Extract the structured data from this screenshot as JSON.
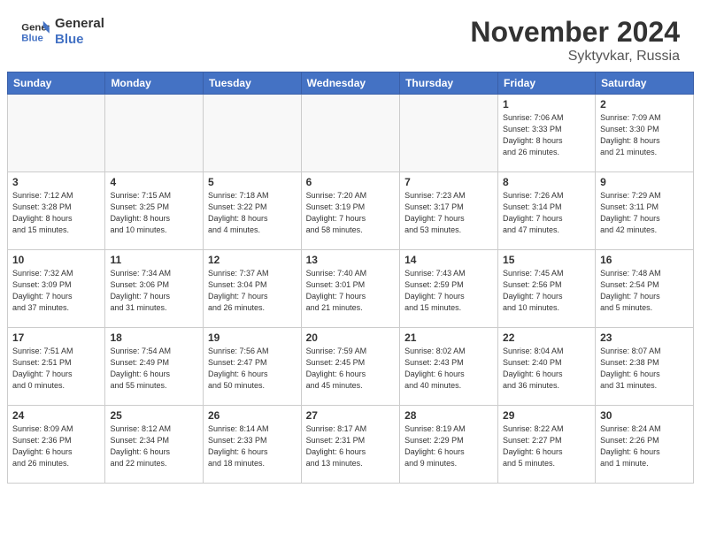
{
  "header": {
    "logo_line1": "General",
    "logo_line2": "Blue",
    "month": "November 2024",
    "location": "Syktyvkar, Russia"
  },
  "weekdays": [
    "Sunday",
    "Monday",
    "Tuesday",
    "Wednesday",
    "Thursday",
    "Friday",
    "Saturday"
  ],
  "rows": [
    [
      {
        "day": "",
        "info": ""
      },
      {
        "day": "",
        "info": ""
      },
      {
        "day": "",
        "info": ""
      },
      {
        "day": "",
        "info": ""
      },
      {
        "day": "",
        "info": ""
      },
      {
        "day": "1",
        "info": "Sunrise: 7:06 AM\nSunset: 3:33 PM\nDaylight: 8 hours\nand 26 minutes."
      },
      {
        "day": "2",
        "info": "Sunrise: 7:09 AM\nSunset: 3:30 PM\nDaylight: 8 hours\nand 21 minutes."
      }
    ],
    [
      {
        "day": "3",
        "info": "Sunrise: 7:12 AM\nSunset: 3:28 PM\nDaylight: 8 hours\nand 15 minutes."
      },
      {
        "day": "4",
        "info": "Sunrise: 7:15 AM\nSunset: 3:25 PM\nDaylight: 8 hours\nand 10 minutes."
      },
      {
        "day": "5",
        "info": "Sunrise: 7:18 AM\nSunset: 3:22 PM\nDaylight: 8 hours\nand 4 minutes."
      },
      {
        "day": "6",
        "info": "Sunrise: 7:20 AM\nSunset: 3:19 PM\nDaylight: 7 hours\nand 58 minutes."
      },
      {
        "day": "7",
        "info": "Sunrise: 7:23 AM\nSunset: 3:17 PM\nDaylight: 7 hours\nand 53 minutes."
      },
      {
        "day": "8",
        "info": "Sunrise: 7:26 AM\nSunset: 3:14 PM\nDaylight: 7 hours\nand 47 minutes."
      },
      {
        "day": "9",
        "info": "Sunrise: 7:29 AM\nSunset: 3:11 PM\nDaylight: 7 hours\nand 42 minutes."
      }
    ],
    [
      {
        "day": "10",
        "info": "Sunrise: 7:32 AM\nSunset: 3:09 PM\nDaylight: 7 hours\nand 37 minutes."
      },
      {
        "day": "11",
        "info": "Sunrise: 7:34 AM\nSunset: 3:06 PM\nDaylight: 7 hours\nand 31 minutes."
      },
      {
        "day": "12",
        "info": "Sunrise: 7:37 AM\nSunset: 3:04 PM\nDaylight: 7 hours\nand 26 minutes."
      },
      {
        "day": "13",
        "info": "Sunrise: 7:40 AM\nSunset: 3:01 PM\nDaylight: 7 hours\nand 21 minutes."
      },
      {
        "day": "14",
        "info": "Sunrise: 7:43 AM\nSunset: 2:59 PM\nDaylight: 7 hours\nand 15 minutes."
      },
      {
        "day": "15",
        "info": "Sunrise: 7:45 AM\nSunset: 2:56 PM\nDaylight: 7 hours\nand 10 minutes."
      },
      {
        "day": "16",
        "info": "Sunrise: 7:48 AM\nSunset: 2:54 PM\nDaylight: 7 hours\nand 5 minutes."
      }
    ],
    [
      {
        "day": "17",
        "info": "Sunrise: 7:51 AM\nSunset: 2:51 PM\nDaylight: 7 hours\nand 0 minutes."
      },
      {
        "day": "18",
        "info": "Sunrise: 7:54 AM\nSunset: 2:49 PM\nDaylight: 6 hours\nand 55 minutes."
      },
      {
        "day": "19",
        "info": "Sunrise: 7:56 AM\nSunset: 2:47 PM\nDaylight: 6 hours\nand 50 minutes."
      },
      {
        "day": "20",
        "info": "Sunrise: 7:59 AM\nSunset: 2:45 PM\nDaylight: 6 hours\nand 45 minutes."
      },
      {
        "day": "21",
        "info": "Sunrise: 8:02 AM\nSunset: 2:43 PM\nDaylight: 6 hours\nand 40 minutes."
      },
      {
        "day": "22",
        "info": "Sunrise: 8:04 AM\nSunset: 2:40 PM\nDaylight: 6 hours\nand 36 minutes."
      },
      {
        "day": "23",
        "info": "Sunrise: 8:07 AM\nSunset: 2:38 PM\nDaylight: 6 hours\nand 31 minutes."
      }
    ],
    [
      {
        "day": "24",
        "info": "Sunrise: 8:09 AM\nSunset: 2:36 PM\nDaylight: 6 hours\nand 26 minutes."
      },
      {
        "day": "25",
        "info": "Sunrise: 8:12 AM\nSunset: 2:34 PM\nDaylight: 6 hours\nand 22 minutes."
      },
      {
        "day": "26",
        "info": "Sunrise: 8:14 AM\nSunset: 2:33 PM\nDaylight: 6 hours\nand 18 minutes."
      },
      {
        "day": "27",
        "info": "Sunrise: 8:17 AM\nSunset: 2:31 PM\nDaylight: 6 hours\nand 13 minutes."
      },
      {
        "day": "28",
        "info": "Sunrise: 8:19 AM\nSunset: 2:29 PM\nDaylight: 6 hours\nand 9 minutes."
      },
      {
        "day": "29",
        "info": "Sunrise: 8:22 AM\nSunset: 2:27 PM\nDaylight: 6 hours\nand 5 minutes."
      },
      {
        "day": "30",
        "info": "Sunrise: 8:24 AM\nSunset: 2:26 PM\nDaylight: 6 hours\nand 1 minute."
      }
    ]
  ]
}
